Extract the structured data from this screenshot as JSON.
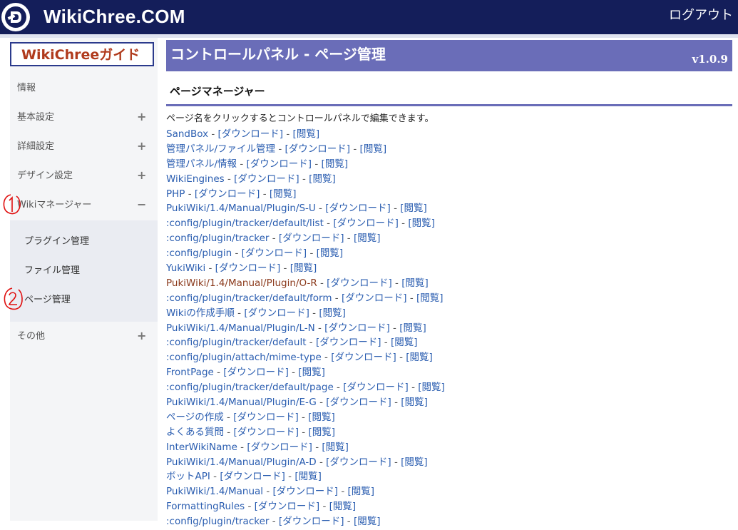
{
  "header": {
    "site_title": "WikiChree.COM",
    "logout_label": "ログアウト"
  },
  "sidebar": {
    "guide_label": "WikiChreeガイド",
    "items": [
      {
        "label": "情報"
      },
      {
        "label": "基本設定",
        "toggle": "+"
      },
      {
        "label": "詳細設定",
        "toggle": "+"
      },
      {
        "label": "デザイン設定",
        "toggle": "+"
      },
      {
        "label": "Wikiマネージャー",
        "toggle": "−"
      },
      {
        "label": "その他",
        "toggle": "+"
      }
    ],
    "sub_items": [
      {
        "label": "プラグイン管理"
      },
      {
        "label": "ファイル管理"
      },
      {
        "label": "ページ管理"
      }
    ],
    "annotations": [
      "1",
      "2"
    ]
  },
  "main": {
    "title": "コントロールパネル - ページ管理",
    "version": "v1.0.9",
    "section_title": "ページマネージャー",
    "description": "ページ名をクリックするとコントロールパネルで編集できます。",
    "separator": " - ",
    "download_label": "[ダウンロード]",
    "view_label": "[閲覧]",
    "pages": [
      {
        "name": "SandBox"
      },
      {
        "name": "管理パネル/ファイル管理"
      },
      {
        "name": "管理パネル/情報"
      },
      {
        "name": "WikiEngines"
      },
      {
        "name": "PHP"
      },
      {
        "name": "PukiWiki/1.4/Manual/Plugin/S-U"
      },
      {
        "name": ":config/plugin/tracker/default/list"
      },
      {
        "name": ":config/plugin/tracker"
      },
      {
        "name": ":config/plugin"
      },
      {
        "name": "YukiWiki"
      },
      {
        "name": "PukiWiki/1.4/Manual/Plugin/O-R",
        "visited": true
      },
      {
        "name": ":config/plugin/tracker/default/form"
      },
      {
        "name": "Wikiの作成手順"
      },
      {
        "name": "PukiWiki/1.4/Manual/Plugin/L-N"
      },
      {
        "name": ":config/plugin/tracker/default"
      },
      {
        "name": ":config/plugin/attach/mime-type"
      },
      {
        "name": "FrontPage"
      },
      {
        "name": ":config/plugin/tracker/default/page"
      },
      {
        "name": "PukiWiki/1.4/Manual/Plugin/E-G"
      },
      {
        "name": "ページの作成"
      },
      {
        "name": "よくある質問"
      },
      {
        "name": "InterWikiName"
      },
      {
        "name": "PukiWiki/1.4/Manual/Plugin/A-D"
      },
      {
        "name": "ボットAPI"
      },
      {
        "name": "PukiWiki/1.4/Manual"
      },
      {
        "name": "FormattingRules"
      },
      {
        "name": ":config/plugin/tracker"
      }
    ]
  },
  "colors": {
    "header_bg": "#141e5a",
    "accent": "#6a6db8",
    "link": "#2a5db0",
    "visited_link": "#8b3a1c",
    "annotation": "#e01010"
  }
}
